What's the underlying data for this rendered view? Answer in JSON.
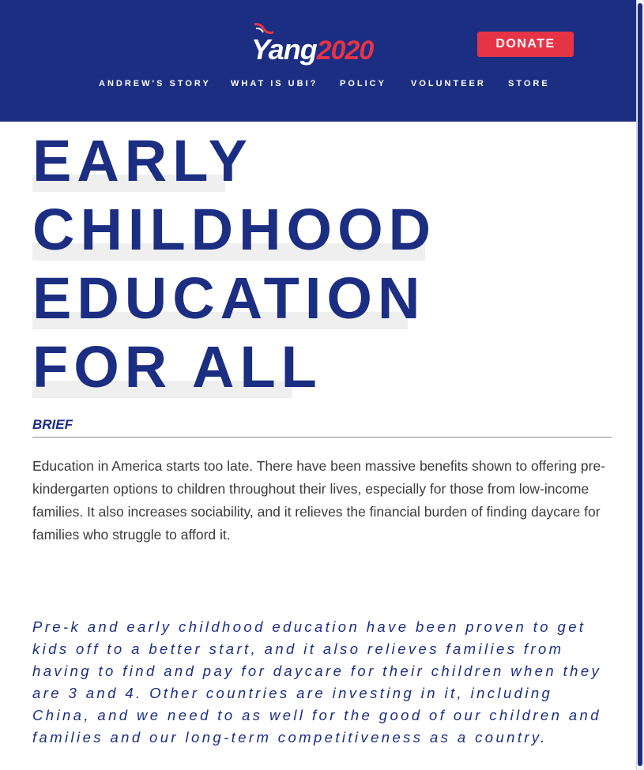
{
  "header": {
    "logo": {
      "name": "Yang",
      "year": "2020"
    },
    "donate_label": "DONATE",
    "nav": [
      {
        "label": "ANDREW'S STORY"
      },
      {
        "label": "WHAT IS UBI?"
      },
      {
        "label": "POLICY"
      },
      {
        "label": "VOLUNTEER"
      },
      {
        "label": "STORE"
      }
    ]
  },
  "page": {
    "title_lines": [
      "EARLY",
      "CHILDHOOD",
      "EDUCATION",
      "FOR ALL"
    ],
    "brief_label": "BRIEF",
    "brief_text": "Education in America starts too late. There have been massive benefits shown to offering pre-kindergarten options to children throughout their lives, especially for those from low-income families. It also increases sociability, and it relieves the financial burden of finding daycare for families who struggle to afford it.",
    "quote": "Pre-k and early childhood education have been proven to get kids off to a better start, and it also relieves families from having to find and pay for daycare for their children when they are 3 and 4. Other countries are investing in it, including China, and we need to as well for the good of our children and families and our long-term competitiveness as a country."
  },
  "colors": {
    "brand_navy": "#1b2e82",
    "brand_red": "#e63446",
    "highlight_gray": "#efefef"
  }
}
